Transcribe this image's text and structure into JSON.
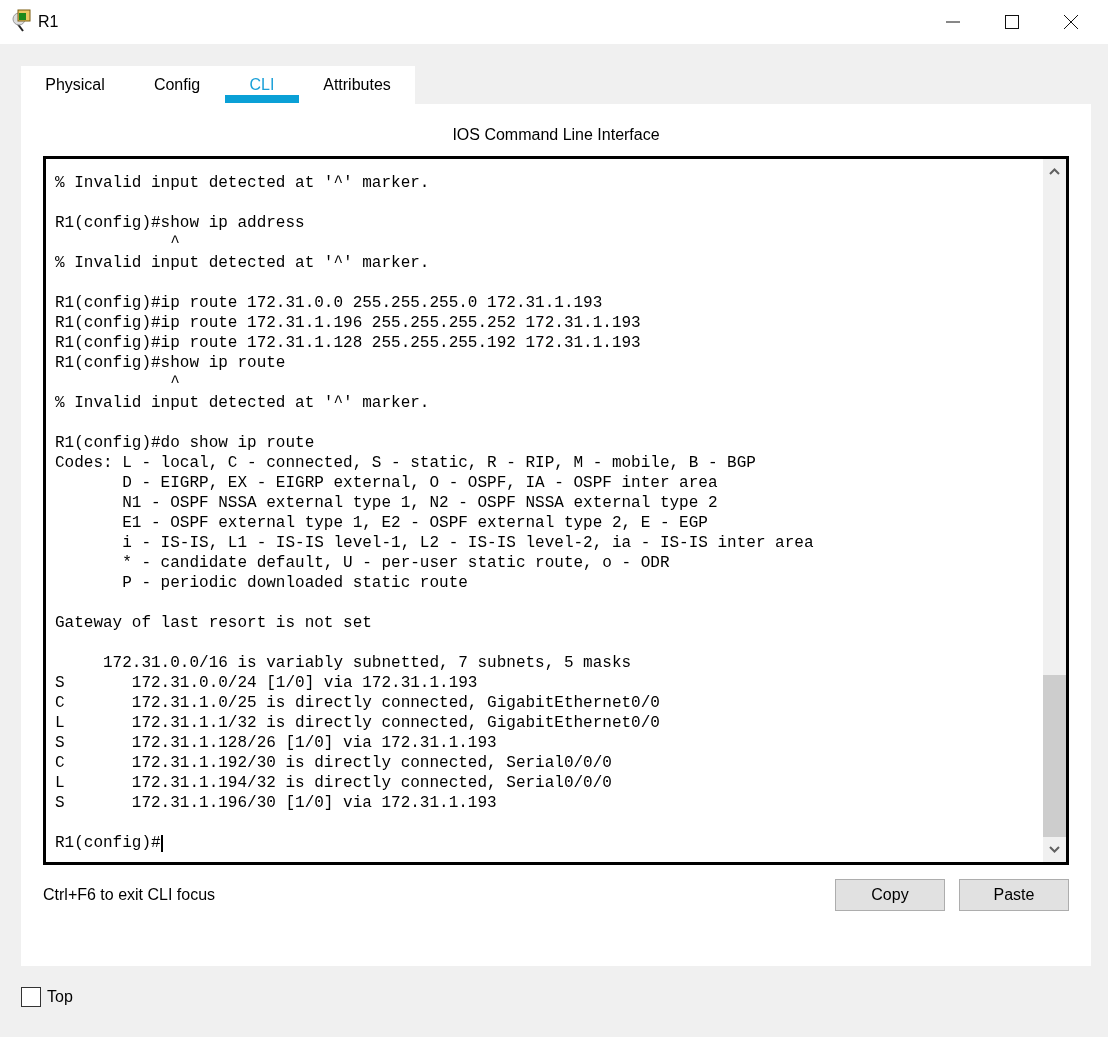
{
  "window": {
    "title": "R1"
  },
  "tabs": [
    {
      "label": "Physical",
      "selected": false
    },
    {
      "label": "Config",
      "selected": false
    },
    {
      "label": "CLI",
      "selected": true
    },
    {
      "label": "Attributes",
      "selected": false
    }
  ],
  "cli": {
    "heading": "IOS Command Line Interface",
    "blocks": [
      [
        "% Invalid input detected at '^' marker."
      ],
      [
        "R1(config)#show ip address",
        "            ^",
        "% Invalid input detected at '^' marker."
      ],
      [
        "R1(config)#ip route 172.31.0.0 255.255.255.0 172.31.1.193",
        "R1(config)#ip route 172.31.1.196 255.255.255.252 172.31.1.193",
        "R1(config)#ip route 172.31.1.128 255.255.255.192 172.31.1.193",
        "R1(config)#show ip route",
        "            ^",
        "% Invalid input detected at '^' marker."
      ],
      [
        "R1(config)#do show ip route",
        "Codes: L - local, C - connected, S - static, R - RIP, M - mobile, B - BGP",
        "       D - EIGRP, EX - EIGRP external, O - OSPF, IA - OSPF inter area",
        "       N1 - OSPF NSSA external type 1, N2 - OSPF NSSA external type 2",
        "       E1 - OSPF external type 1, E2 - OSPF external type 2, E - EGP",
        "       i - IS-IS, L1 - IS-IS level-1, L2 - IS-IS level-2, ia - IS-IS inter area",
        "       * - candidate default, U - per-user static route, o - ODR",
        "       P - periodic downloaded static route"
      ],
      [
        "Gateway of last resort is not set"
      ],
      [
        "     172.31.0.0/16 is variably subnetted, 7 subnets, 5 masks",
        "S       172.31.0.0/24 [1/0] via 172.31.1.193",
        "C       172.31.1.0/25 is directly connected, GigabitEthernet0/0",
        "L       172.31.1.1/32 is directly connected, GigabitEthernet0/0",
        "S       172.31.1.128/26 [1/0] via 172.31.1.193",
        "C       172.31.1.192/30 is directly connected, Serial0/0/0",
        "L       172.31.1.194/32 is directly connected, Serial0/0/0",
        "S       172.31.1.196/30 [1/0] via 172.31.1.193"
      ]
    ],
    "prompt": "R1(config)#",
    "hint": "Ctrl+F6 to exit CLI focus",
    "buttons": [
      "Copy",
      "Paste"
    ]
  },
  "top_checkbox": {
    "label": "Top",
    "checked": false
  }
}
